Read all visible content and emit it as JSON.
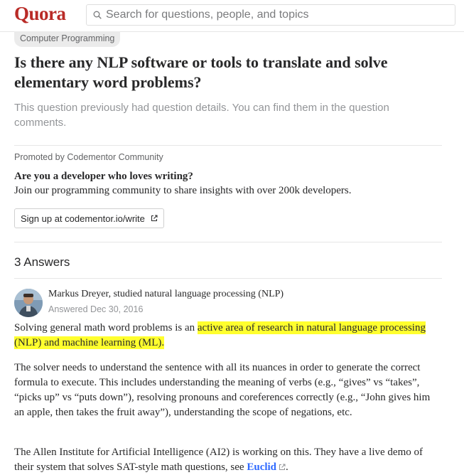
{
  "header": {
    "logo": "Quora",
    "search_placeholder": "Search for questions, people, and topics"
  },
  "question": {
    "topic": "Computer Programming",
    "title": "Is there any NLP software or tools to translate and solve elementary word problems?",
    "details_note": "This question previously had question details. You can find them in the question comments."
  },
  "promo": {
    "label": "Promoted by Codementor Community",
    "title": "Are you a developer who loves writing?",
    "text": "Join our programming community to share insights with over 200k developers.",
    "button_label": "Sign up at codementor.io/write"
  },
  "answers": {
    "count_label": "3 Answers",
    "author": "Markus Dreyer, studied natural language processing (NLP)",
    "date": "Answered Dec 30, 2016",
    "p1_before": "Solving general math word problems is an ",
    "p1_highlight": "active area of research in natural language processing (NLP) and machine learning (ML).",
    "p2": "The solver needs to understand the sentence with all its nuances in order to generate the correct formula to execute. This includes understanding the meaning of verbs (e.g., “gives” vs “takes”, “picks up” vs “puts down”), resolving pronouns and coreferences correctly (e.g., “John gives him an apple, then takes the fruit away”), understanding the scope of negations, etc.",
    "p3_before": "The Allen Institute for Artificial Intelligence (AI2) is working on this. They have a live demo of their system that solves SAT-style math questions, see ",
    "p3_link": "Euclid",
    "p3_after": "."
  },
  "colors": {
    "brand": "#b92b27",
    "highlight": "#ffff2e",
    "link": "#2e69ff"
  },
  "icons": [
    "search-icon",
    "external-link-icon",
    "avatar"
  ]
}
